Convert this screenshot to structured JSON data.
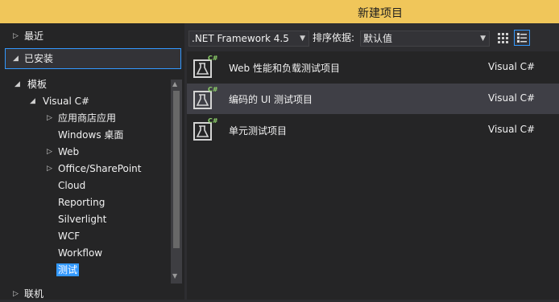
{
  "window": {
    "title": "新建项目"
  },
  "tree": {
    "recent": "最近",
    "installed": "已安装",
    "templates": "模板",
    "visual_csharp": "Visual C#",
    "children": [
      {
        "label": "应用商店应用",
        "expandable": true
      },
      {
        "label": "Windows 桌面",
        "expandable": false
      },
      {
        "label": "Web",
        "expandable": true
      },
      {
        "label": "Office/SharePoint",
        "expandable": true
      },
      {
        "label": "Cloud",
        "expandable": false
      },
      {
        "label": "Reporting",
        "expandable": false
      },
      {
        "label": "Silverlight",
        "expandable": false
      },
      {
        "label": "WCF",
        "expandable": false
      },
      {
        "label": "Workflow",
        "expandable": false
      },
      {
        "label": "测试",
        "expandable": false,
        "selected": true
      }
    ],
    "online": "联机"
  },
  "toolbar": {
    "framework": ".NET Framework 4.5",
    "sort_label": "排序依据:",
    "sort_value": "默认值"
  },
  "templates": [
    {
      "name": "Web 性能和负载测试项目",
      "language": "Visual C#",
      "selected": false
    },
    {
      "name": "编码的 UI 测试项目",
      "language": "Visual C#",
      "selected": true
    },
    {
      "name": "单元测试项目",
      "language": "Visual C#",
      "selected": false
    }
  ],
  "icon_badge": "C#",
  "colors": {
    "accent": "#3399ff",
    "titlebar": "#f0c65a",
    "badge": "#8ed16a"
  }
}
